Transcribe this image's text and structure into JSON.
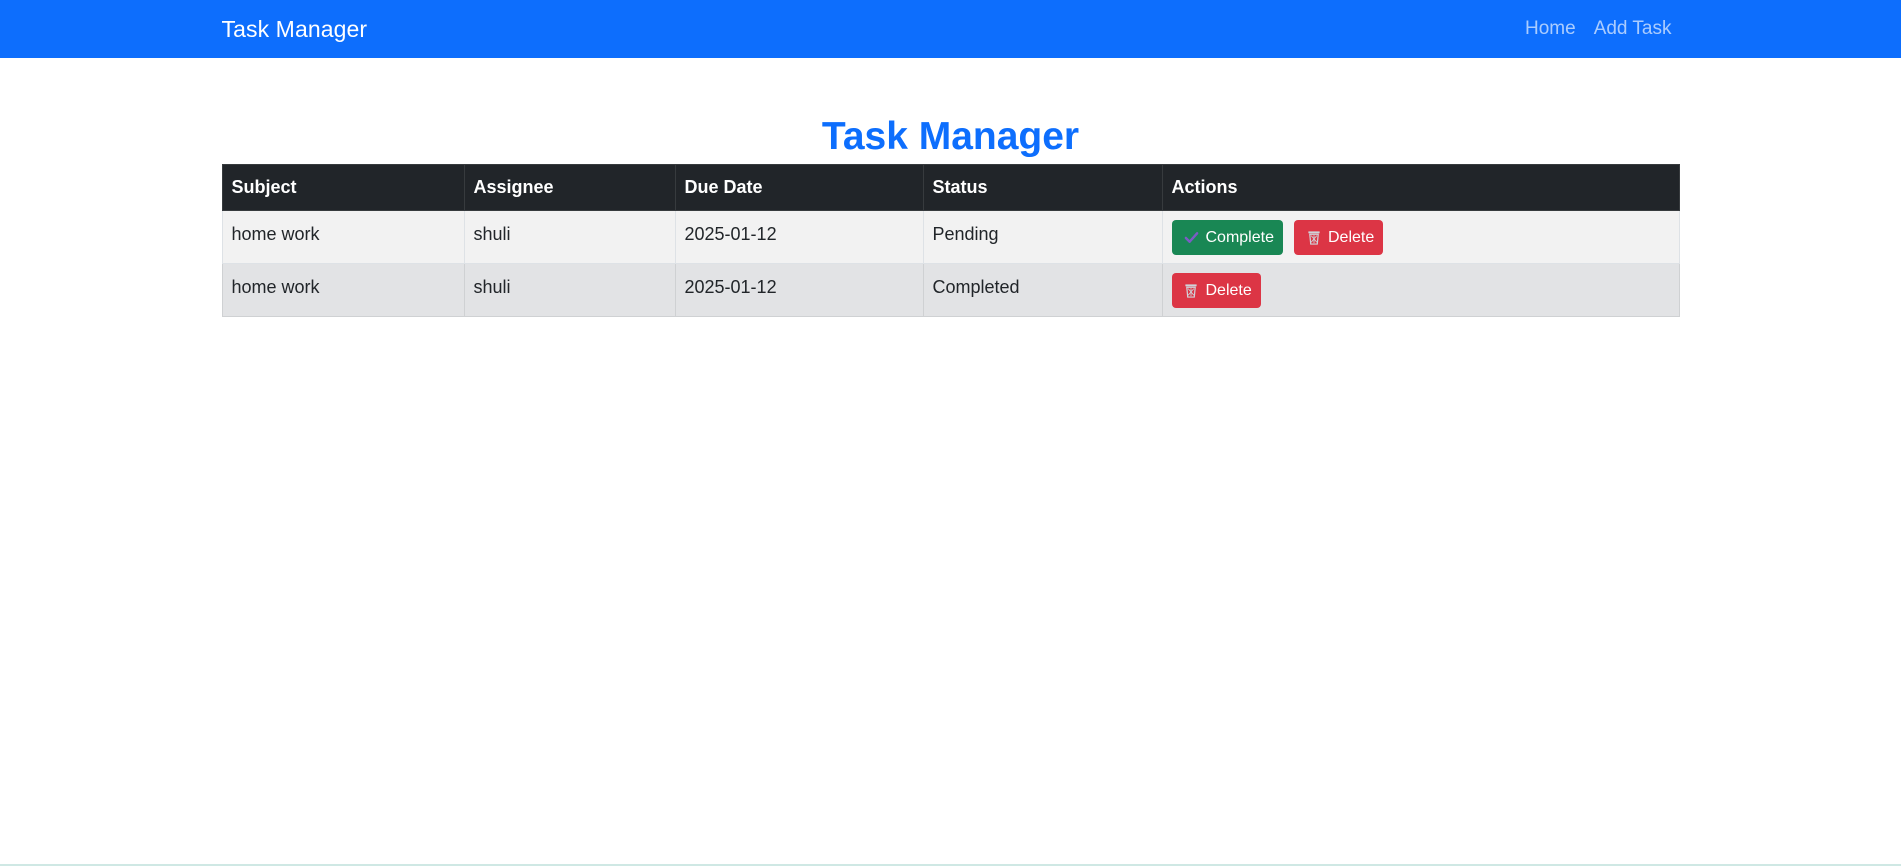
{
  "navbar": {
    "brand": "Task Manager",
    "links": [
      {
        "label": "Home"
      },
      {
        "label": "Add Task"
      }
    ]
  },
  "main": {
    "title": "Task Manager",
    "table": {
      "headers": [
        "Subject",
        "Assignee",
        "Due Date",
        "Status",
        "Actions"
      ],
      "rows": [
        {
          "subject": "home work",
          "assignee": "shuli",
          "due_date": "2025-01-12",
          "status": "Pending",
          "actions": {
            "complete_label": "Complete",
            "delete_label": "Delete"
          }
        },
        {
          "subject": "home work",
          "assignee": "shuli",
          "due_date": "2025-01-12",
          "status": "Completed",
          "actions": {
            "delete_label": "Delete"
          }
        }
      ]
    }
  },
  "colors": {
    "primary": "#0d6efd",
    "success": "#198754",
    "danger": "#dc3545",
    "header_dark": "#212529"
  },
  "icons": {
    "complete": "check-icon",
    "delete": "trash-icon"
  }
}
